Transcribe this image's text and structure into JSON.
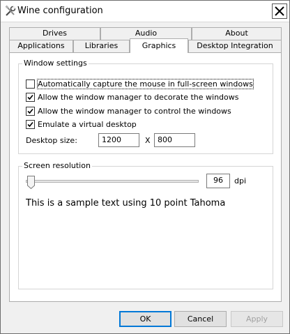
{
  "window": {
    "title": "Wine configuration"
  },
  "tabs": {
    "top_row": [
      "Drives",
      "Audio",
      "About"
    ],
    "bottom_row": [
      "Applications",
      "Libraries",
      "Graphics",
      "Desktop Integration"
    ],
    "active": "Graphics"
  },
  "window_settings": {
    "title": "Window settings",
    "options": [
      {
        "label": "Automatically capture the mouse in full-screen windows",
        "checked": false
      },
      {
        "label": "Allow the window manager to decorate the windows",
        "checked": true
      },
      {
        "label": "Allow the window manager to control the windows",
        "checked": true
      },
      {
        "label": "Emulate a virtual desktop",
        "checked": true
      }
    ],
    "desktop_size_label": "Desktop size:",
    "width": "1200",
    "separator": "X",
    "height": "800"
  },
  "screen_resolution": {
    "title": "Screen resolution",
    "dpi_value": "96",
    "dpi_unit": "dpi",
    "slider_level": 0,
    "sample_text": "This is a sample text using 10 point Tahoma"
  },
  "buttons": {
    "ok": "OK",
    "cancel": "Cancel",
    "apply": "Apply"
  }
}
